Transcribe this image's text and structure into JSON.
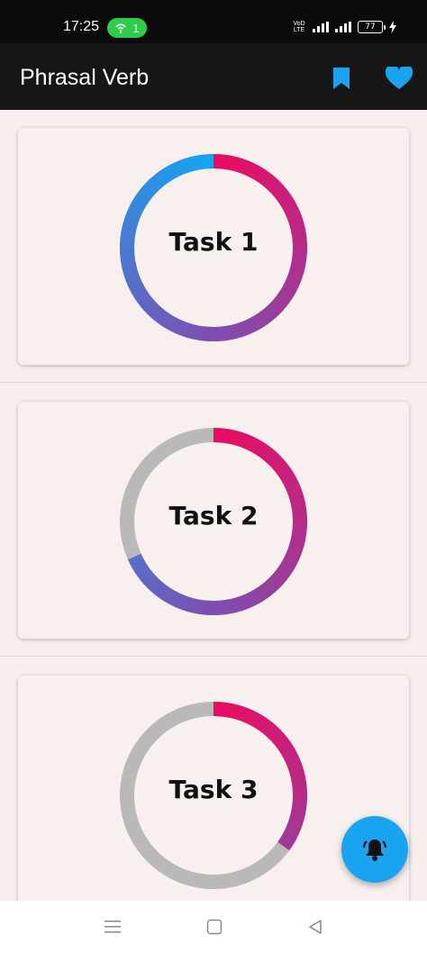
{
  "status_bar": {
    "time": "17:25",
    "hotspot_count": "1",
    "network_label": "VoD LTE",
    "battery": "77"
  },
  "app_bar": {
    "title": "Phrasal Verb",
    "bookmark_icon": "bookmark-icon",
    "heart_icon": "heart-icon"
  },
  "tasks": [
    {
      "label": "Task 1",
      "progress": 1.0
    },
    {
      "label": "Task 2",
      "progress": 0.68
    },
    {
      "label": "Task 3",
      "progress": 0.35
    }
  ],
  "fab": {
    "icon": "bell-ring-icon"
  },
  "nav": [
    "menu-icon",
    "home-square-icon",
    "back-triangle-icon"
  ],
  "colors": {
    "accent": "#1aa3f1",
    "gradient_start": "#ea0b61",
    "gradient_mid": "#7d4fb1",
    "gradient_end": "#12a6f2",
    "track": "#b9b9b9"
  }
}
